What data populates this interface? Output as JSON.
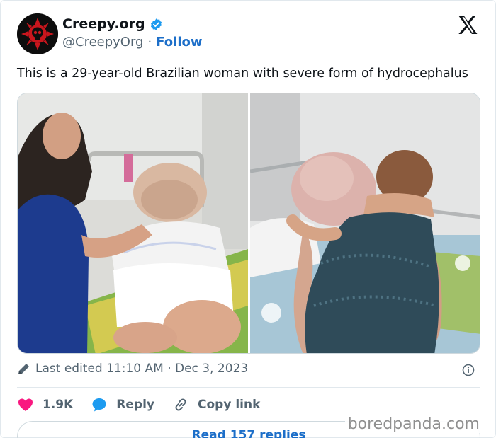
{
  "account": {
    "display_name": "Creepy.org",
    "handle": "@CreepyOrg",
    "separator": "·",
    "follow_label": "Follow"
  },
  "tweet": {
    "text": "This is a 29-year-old Brazilian woman with severe form of hydrocephalus"
  },
  "meta": {
    "edited_label": "Last edited 11:10 AM · Dec 3, 2023"
  },
  "actions": {
    "likes_count": "1.9K",
    "reply_label": "Reply",
    "copy_link_label": "Copy link"
  },
  "replies": {
    "read_label": "Read 157 replies"
  },
  "watermark": "boredpanda.com",
  "colors": {
    "link_blue": "#1d6fc9",
    "like_pink": "#f91880",
    "reply_blue": "#1d9bf0",
    "muted": "#536471"
  },
  "icons": [
    "skull-logo-avatar",
    "verified-badge-icon",
    "x-logo-icon",
    "pencil-icon",
    "info-icon",
    "heart-icon",
    "reply-bubble-icon",
    "link-icon"
  ]
}
